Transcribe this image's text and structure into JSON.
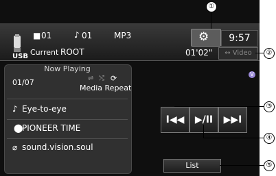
{
  "header": {
    "folder_num": "01",
    "track_num": "01",
    "format": "MP3",
    "source": "USB",
    "current_label": "Current",
    "folder_name": "ROOT",
    "clock": "9:57",
    "elapsed": "01'02\"",
    "video_label": "Video"
  },
  "now_playing": {
    "title": "Now Playing",
    "track_count": "01/07",
    "mode_label": "Media Repeat",
    "song": "Eye-to-eye",
    "artist": "PIONEER TIME",
    "album": "sound.vision.soul"
  },
  "controls": {
    "prev_symbol": "I◀◀",
    "play_pause_symbol": "▶/II",
    "next_symbol": "▶▶I",
    "list_label": "List",
    "v_badge": "V"
  },
  "callouts": [
    "①",
    "②",
    "③",
    "④",
    "⑤"
  ],
  "colors": {
    "background": "#0f0f0f",
    "panel": "#303030",
    "accent_badge": "#9a8ad8"
  }
}
